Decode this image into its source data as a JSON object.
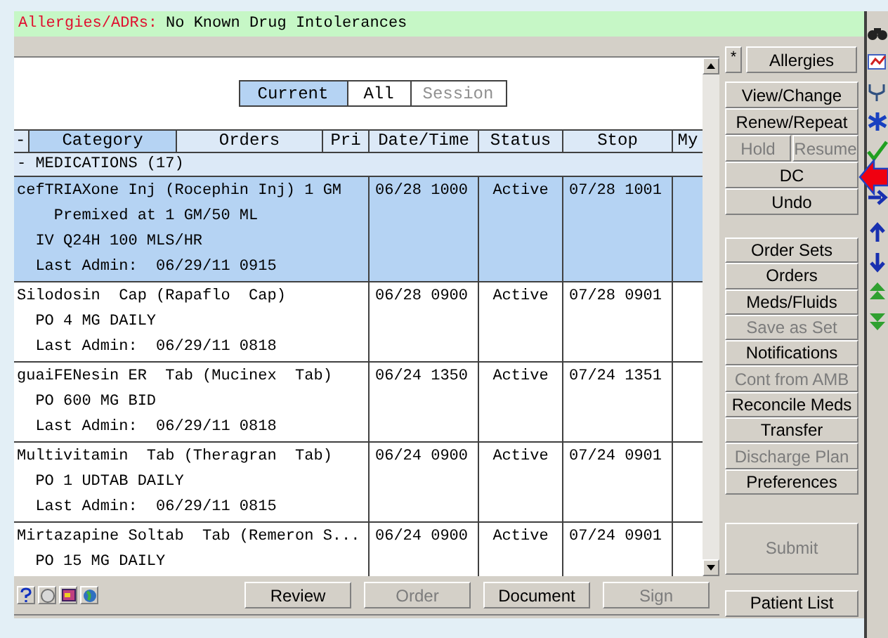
{
  "allergies": {
    "label": "Allergies/ADRs:",
    "value": "No Known Drug Intolerances"
  },
  "view_tabs": [
    {
      "label": "Current",
      "selected": true,
      "disabled": false
    },
    {
      "label": "All",
      "selected": false,
      "disabled": false
    },
    {
      "label": "Session",
      "selected": false,
      "disabled": true
    }
  ],
  "table": {
    "columns": [
      {
        "label": "-",
        "sorted": false
      },
      {
        "label": "Category",
        "sorted": true
      },
      {
        "label": "Orders",
        "sorted": false
      },
      {
        "label": "Pri",
        "sorted": false
      },
      {
        "label": "Date/Time",
        "sorted": false
      },
      {
        "label": "Status",
        "sorted": false
      },
      {
        "label": "Stop",
        "sorted": false
      },
      {
        "label": "My",
        "sorted": false
      }
    ],
    "group": "- MEDICATIONS (17)",
    "rows": [
      {
        "lines": [
          "cefTRIAXone Inj (Rocephin Inj) 1 GM",
          "    Premixed at 1 GM/50 ML",
          "  IV Q24H 100 MLS/HR",
          "  Last Admin:  06/29/11 0915"
        ],
        "date_time": "06/28 1000",
        "status": "Active",
        "stop": "07/28 1001",
        "selected": true
      },
      {
        "lines": [
          "Silodosin  Cap (Rapaflo  Cap)",
          "  PO 4 MG DAILY",
          "  Last Admin:  06/29/11 0818"
        ],
        "date_time": "06/28 0900",
        "status": "Active",
        "stop": "07/28 0901",
        "selected": false
      },
      {
        "lines": [
          "guaiFENesin ER  Tab (Mucinex  Tab)",
          "  PO 600 MG BID",
          "  Last Admin:  06/29/11 0818"
        ],
        "date_time": "06/24 1350",
        "status": "Active",
        "stop": "07/24 1351",
        "selected": false
      },
      {
        "lines": [
          "Multivitamin  Tab (Theragran  Tab)",
          "  PO 1 UDTAB DAILY",
          "  Last Admin:  06/29/11 0815"
        ],
        "date_time": "06/24 0900",
        "status": "Active",
        "stop": "07/24 0901",
        "selected": false
      },
      {
        "lines": [
          "Mirtazapine Soltab  Tab (Remeron S...",
          "  PO 15 MG DAILY"
        ],
        "date_time": "06/24 0900",
        "status": "Active",
        "stop": "07/24 0901",
        "selected": false
      }
    ]
  },
  "bottom_buttons": [
    {
      "label": "Review",
      "disabled": false
    },
    {
      "label": "Order",
      "disabled": true
    },
    {
      "label": "Document",
      "disabled": false
    },
    {
      "label": "Sign",
      "disabled": true
    }
  ],
  "side": {
    "star": "*",
    "allergies": "Allergies",
    "action_rows": [
      [
        {
          "label": "View/Change",
          "disabled": false
        }
      ],
      [
        {
          "label": "Renew/Repeat",
          "disabled": false
        }
      ],
      [
        {
          "label": "Hold",
          "disabled": true
        },
        {
          "label": "Resume",
          "disabled": true
        }
      ],
      [
        {
          "label": "DC",
          "disabled": false
        }
      ],
      [
        {
          "label": "Undo",
          "disabled": false
        }
      ]
    ],
    "nav_buttons": [
      {
        "label": "Order Sets",
        "disabled": false
      },
      {
        "label": "Orders",
        "disabled": false
      },
      {
        "label": "Meds/Fluids",
        "disabled": false
      },
      {
        "label": "Save as Set",
        "disabled": true
      },
      {
        "label": "Notifications",
        "disabled": false
      },
      {
        "label": "Cont from AMB",
        "disabled": true
      },
      {
        "label": "Reconcile Meds",
        "disabled": false
      },
      {
        "label": "Transfer",
        "disabled": false
      },
      {
        "label": "Discharge Plan",
        "disabled": true
      },
      {
        "label": "Preferences",
        "disabled": false
      }
    ],
    "submit": {
      "label": "Submit",
      "disabled": true
    },
    "patient_list": "Patient List"
  }
}
